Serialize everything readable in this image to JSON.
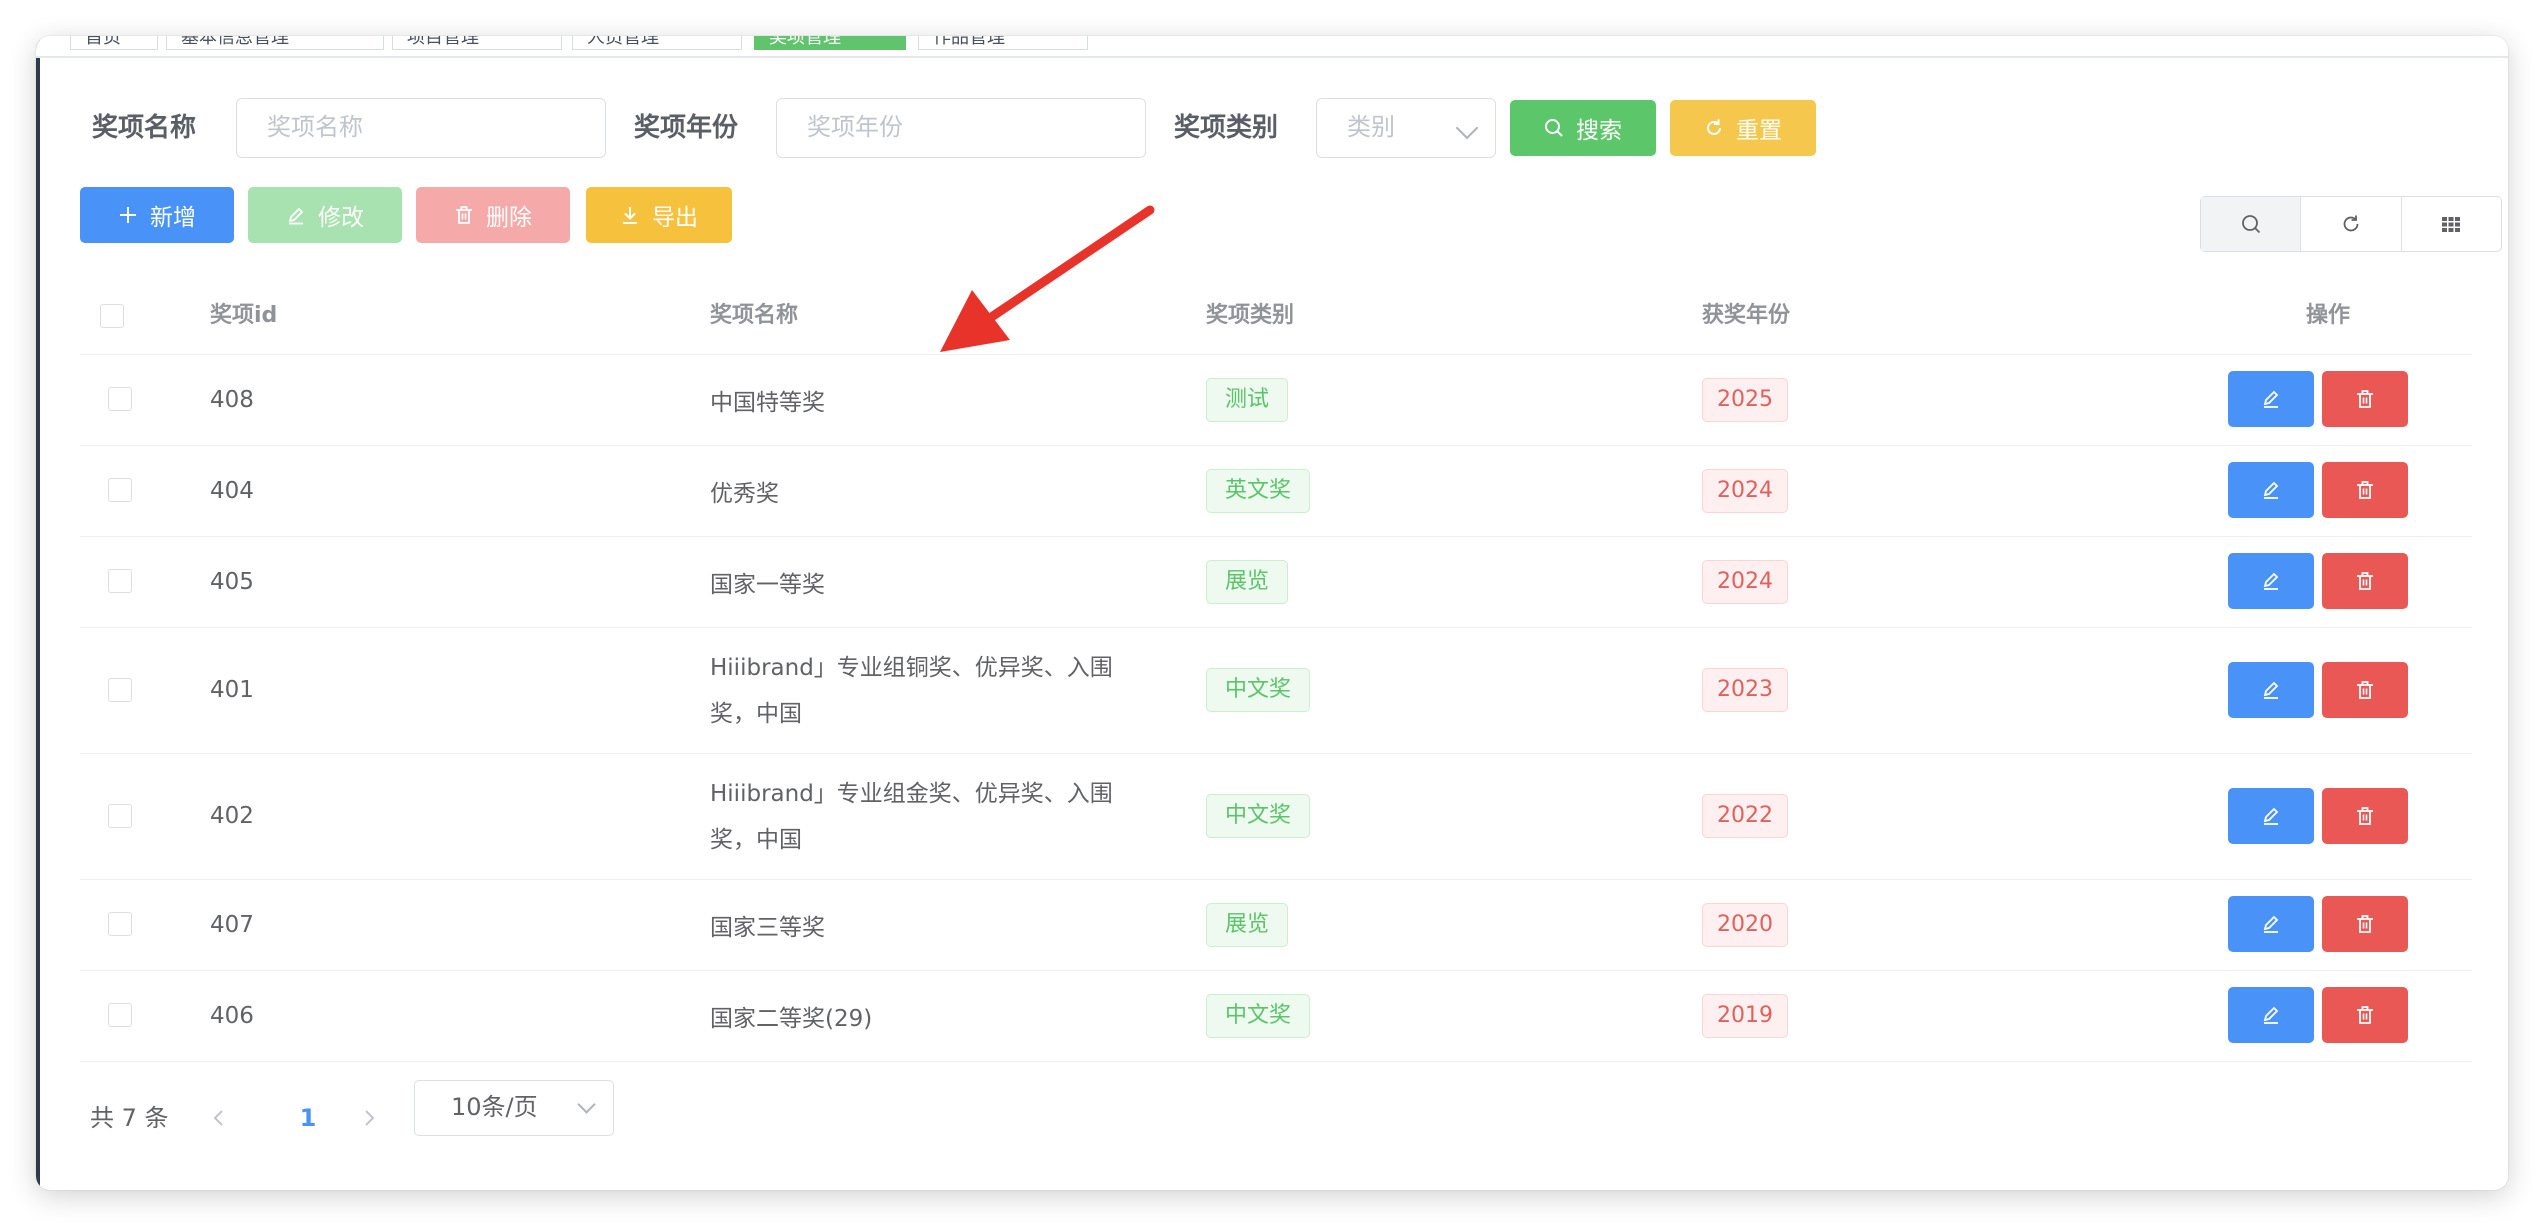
{
  "tags": [
    "首页",
    "基本信息管理",
    "项目管理",
    "人员管理",
    "奖项管理",
    "作品管理"
  ],
  "search": {
    "name_label": "奖项名称",
    "name_placeholder": "奖项名称",
    "year_label": "奖项年份",
    "year_placeholder": "奖项年份",
    "type_label": "奖项类别",
    "type_placeholder": "类别",
    "search_button": "搜索",
    "reset_button": "重置"
  },
  "toolbar": {
    "add": "新增",
    "edit": "修改",
    "delete": "删除",
    "export": "导出"
  },
  "table": {
    "headers": {
      "id": "奖项id",
      "name": "奖项名称",
      "type": "奖项类别",
      "year": "获奖年份",
      "ops": "操作"
    },
    "rows": [
      {
        "id": "408",
        "name": "中国特等奖",
        "type": "测试",
        "year": "2025"
      },
      {
        "id": "404",
        "name": "优秀奖",
        "type": "英文奖",
        "year": "2024"
      },
      {
        "id": "405",
        "name": "国家一等奖",
        "type": "展览",
        "year": "2024"
      },
      {
        "id": "401",
        "name_line1": "Hiiibrand」专业组铜奖、优异奖、入围",
        "name_line2": "奖，中国",
        "type": "中文奖",
        "year": "2023"
      },
      {
        "id": "402",
        "name_line1": "Hiiibrand」专业组金奖、优异奖、入围",
        "name_line2": "奖，中国",
        "type": "中文奖",
        "year": "2022"
      },
      {
        "id": "407",
        "name": "国家三等奖",
        "type": "展览",
        "year": "2020"
      },
      {
        "id": "406",
        "name": "国家二等奖(29)",
        "type": "中文奖",
        "year": "2019"
      }
    ]
  },
  "pagination": {
    "total": "共 7 条",
    "current_page": "1",
    "page_size": "10条/页"
  },
  "colors": {
    "primary": "#4992f8",
    "success": "#5cc76a",
    "warning": "#f6c74d",
    "danger": "#e95855",
    "annotation_arrow": "#e8332a"
  }
}
